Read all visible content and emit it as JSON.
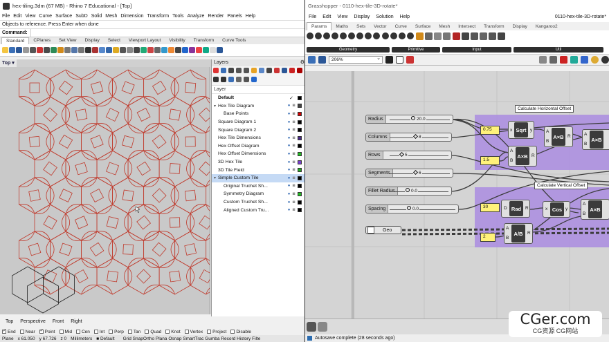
{
  "rhino": {
    "title": "hex-tiling.3dm (67 MB) - Rhino 7 Educational - [Top]",
    "menu": [
      "File",
      "Edit",
      "View",
      "Curve",
      "Surface",
      "SubD",
      "Solid",
      "Mesh",
      "Dimension",
      "Transform",
      "Tools",
      "Analyze",
      "Render",
      "Panels",
      "Help"
    ],
    "command_history": "Objects to reference. Press Enter when done",
    "command_label": "Command:",
    "toolbar_tabs": [
      "Standard",
      "CPlanes",
      "Set View",
      "Display",
      "Select",
      "Viewport Layout",
      "Visibility",
      "Transform",
      "Curve Tools"
    ],
    "active_toolbar_tab": "Standard",
    "viewport_name": "Top",
    "viewport_tabs": [
      "Top",
      "Perspective",
      "Front",
      "Right"
    ],
    "osnaps": [
      {
        "label": "End",
        "on": true
      },
      {
        "label": "Near",
        "on": false
      },
      {
        "label": "Point",
        "on": true
      },
      {
        "label": "Mid",
        "on": false
      },
      {
        "label": "Cen",
        "on": false
      },
      {
        "label": "Int",
        "on": false
      },
      {
        "label": "Perp",
        "on": false
      },
      {
        "label": "Tan",
        "on": false
      },
      {
        "label": "Quad",
        "on": false
      },
      {
        "label": "Knot",
        "on": false
      },
      {
        "label": "Vertex",
        "on": false
      },
      {
        "label": "Project",
        "on": false
      },
      {
        "label": "Disable",
        "on": false
      }
    ],
    "status": {
      "plane": "Plane",
      "x": "x 61.050",
      "y": "y 67.726",
      "z": "z 0",
      "units": "Millimeters",
      "layer": "Default",
      "toggles": "Grid SnapOrtho Plana Osnap SmartTrac Gumba Record History Filte"
    },
    "layers_panel": {
      "tab": "Layers",
      "column_title": "Layer",
      "layers": [
        {
          "name": "Default",
          "indent": 0,
          "bold": true,
          "current": true,
          "color": "#000000",
          "caret": ""
        },
        {
          "name": "Hex Tile Diagram",
          "indent": 0,
          "bold": false,
          "current": false,
          "color": "#444444",
          "caret": "▾"
        },
        {
          "name": "Base Points",
          "indent": 1,
          "bold": false,
          "current": false,
          "color": "#d40000",
          "caret": ""
        },
        {
          "name": "Square Diagram 1",
          "indent": 0,
          "bold": false,
          "current": false,
          "color": "#000000",
          "caret": ""
        },
        {
          "name": "Square Diagram 2",
          "indent": 0,
          "bold": false,
          "current": false,
          "color": "#000000",
          "caret": ""
        },
        {
          "name": "Hex Tile Dimensions",
          "indent": 0,
          "bold": false,
          "current": false,
          "color": "#4a2a8a",
          "caret": ""
        },
        {
          "name": "Hex Offset Diagram",
          "indent": 0,
          "bold": false,
          "current": false,
          "color": "#000000",
          "caret": ""
        },
        {
          "name": "Hex Offset Dimensions",
          "indent": 0,
          "bold": false,
          "current": false,
          "color": "#22bb22",
          "caret": ""
        },
        {
          "name": "3D Hex Tile",
          "indent": 0,
          "bold": false,
          "current": false,
          "color": "#7a3fd0",
          "caret": ""
        },
        {
          "name": "3D Tile Field",
          "indent": 0,
          "bold": false,
          "current": false,
          "color": "#22aa22",
          "caret": ""
        },
        {
          "name": "Simple Custom Tile",
          "indent": 0,
          "bold": false,
          "current": false,
          "color": "#000000",
          "caret": "▾",
          "selected": true
        },
        {
          "name": "Original Truchet Sh...",
          "indent": 1,
          "bold": false,
          "current": false,
          "color": "#000000",
          "caret": ""
        },
        {
          "name": "Symmetry Diagram",
          "indent": 1,
          "bold": false,
          "current": false,
          "color": "#22bb22",
          "caret": ""
        },
        {
          "name": "Custom Truchet Sh...",
          "indent": 1,
          "bold": false,
          "current": false,
          "color": "#000000",
          "caret": ""
        },
        {
          "name": "Aligned Custom Tru...",
          "indent": 1,
          "bold": false,
          "current": false,
          "color": "#000000",
          "caret": ""
        }
      ]
    }
  },
  "gh": {
    "title": "Grasshopper - 0110-hex-tile-3D-rotate*",
    "menu": [
      "File",
      "Edit",
      "View",
      "Display",
      "Solution",
      "Help"
    ],
    "doc_name": "0110-hex-tile-3D-rotate*",
    "tabs": [
      "Params",
      "Maths",
      "Sets",
      "Vector",
      "Curve",
      "Surface",
      "Mesh",
      "Intersect",
      "Transform",
      "Display",
      "Kangaroo2"
    ],
    "active_tab": "Params",
    "categories": [
      "Geometry",
      "Primitive",
      "Input",
      "Util"
    ],
    "zoom": "206%",
    "status": "Autosave complete (28 seconds ago)",
    "groups": {
      "horizontal": "Calculate Horizontal Offset",
      "vertical": "Calculate Vertical Offset"
    },
    "sliders": [
      {
        "name": "Radius",
        "value": "20.0",
        "shape": "circle"
      },
      {
        "name": "Columns",
        "value": "8",
        "shape": "diamond"
      },
      {
        "name": "Rows",
        "value": "5",
        "shape": "diamond"
      },
      {
        "name": "Segments",
        "value": "6",
        "shape": "diamond"
      },
      {
        "name": "Fillet Radius",
        "value": "0.0",
        "shape": "circle"
      },
      {
        "name": "Spacing",
        "value": "0.0",
        "shape": "circle"
      }
    ],
    "panels": [
      "0.75",
      "1.5",
      "30",
      "2"
    ],
    "components": {
      "sqrt": {
        "label": "Sqrt",
        "in": "x",
        "out": "y"
      },
      "mult1": {
        "label": "A×B",
        "in_a": "A",
        "in_b": "B",
        "out": "R"
      },
      "mult2": {
        "label": "A×B",
        "in_a": "A",
        "in_b": "B",
        "out": "R"
      },
      "mult3": {
        "label": "A×B",
        "in_a": "A",
        "in_b": "B",
        "out": "R"
      },
      "mult4": {
        "label": "A×B",
        "in_a": "A",
        "in_b": "B",
        "out": "R"
      },
      "rad": {
        "label": "Rad",
        "in": "D",
        "out": "R"
      },
      "cos": {
        "label": "Cos",
        "in": "x",
        "out": "y"
      },
      "div": {
        "label": "A/B",
        "in_a": "A",
        "in_b": "B",
        "out": "R"
      }
    },
    "geo_param": "Geo"
  },
  "watermark": {
    "main": "CGer.com",
    "sub": "CG资源  CG网站"
  },
  "colors": {
    "group_fill": "#a98ce1",
    "panel_yellow": "#fff27a",
    "curve_red": "#c0392b",
    "selection_blue": "#c5daf5"
  }
}
